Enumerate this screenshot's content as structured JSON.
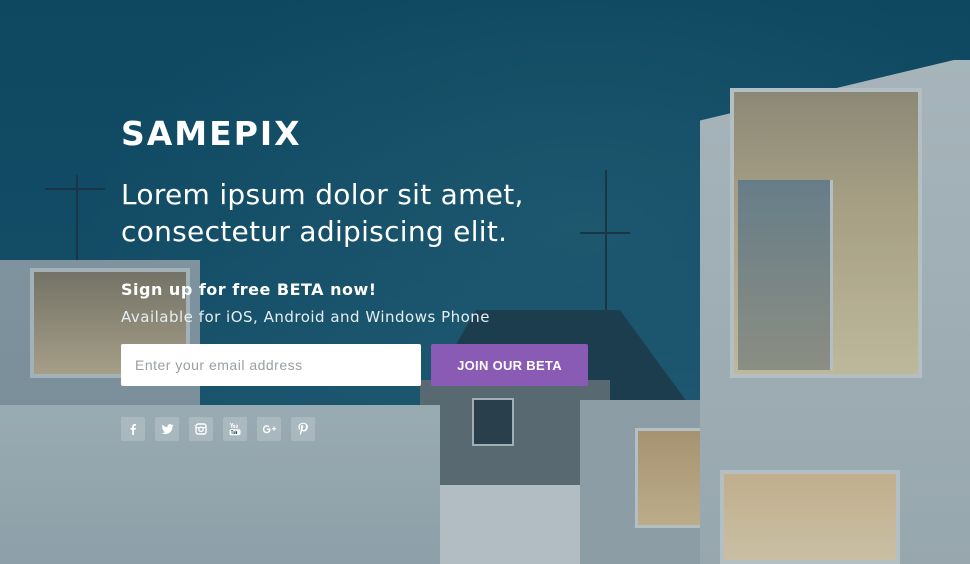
{
  "brand": {
    "logo_text": "SAMEPIX"
  },
  "hero": {
    "headline_line1": "Lorem ipsum dolor sit amet,",
    "headline_line2": "consectetur adipiscing elit.",
    "signup_title": "Sign up for free BETA now!",
    "platforms_text": "Available for iOS, Android and Windows Phone"
  },
  "form": {
    "email_placeholder": "Enter your email address",
    "email_value": "",
    "submit_label": "JOIN OUR BETA"
  },
  "social": {
    "icons": [
      "facebook-icon",
      "twitter-icon",
      "instagram-icon",
      "youtube-icon",
      "google-plus-icon",
      "pinterest-icon"
    ]
  },
  "colors": {
    "button_bg": "#8a5bb5",
    "text": "#ffffff",
    "background_tint": "#14506a"
  }
}
